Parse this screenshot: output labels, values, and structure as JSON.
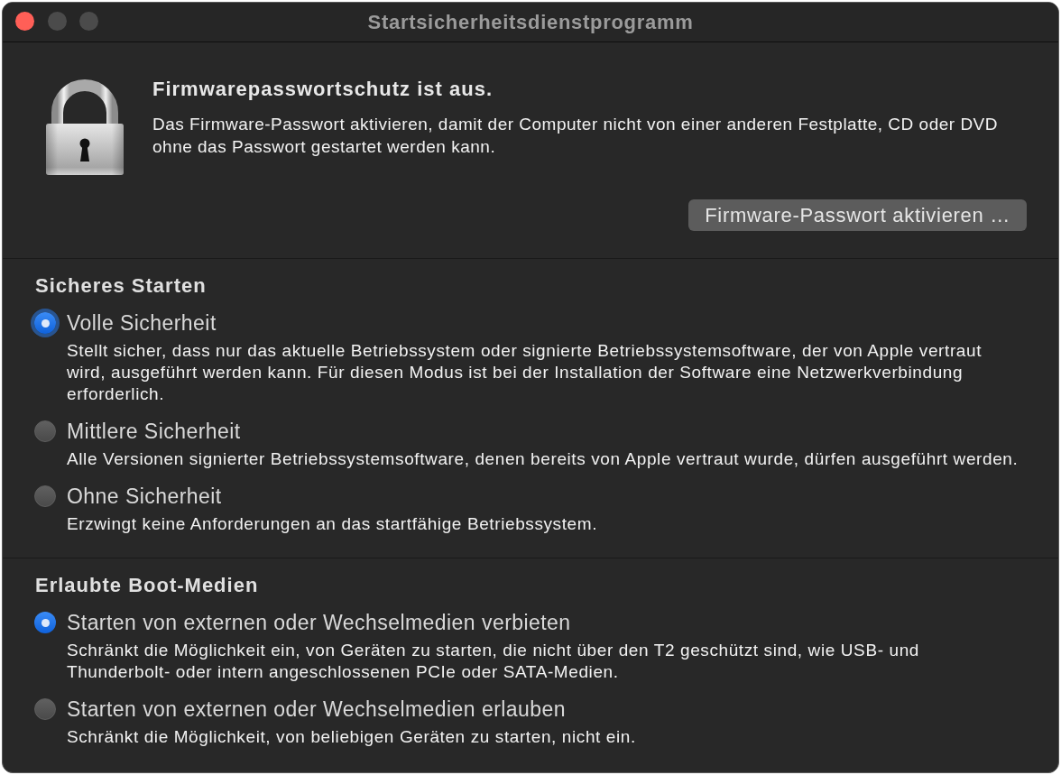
{
  "window": {
    "title": "Startsicherheitsdienstprogramm",
    "controls": [
      {
        "kind": "close",
        "disabled": false
      },
      {
        "kind": "minimize",
        "disabled": true
      },
      {
        "kind": "zoom",
        "disabled": true
      }
    ]
  },
  "firmware": {
    "heading": "Firmwarepasswortschutz ist aus.",
    "description": "Das Firmware-Passwort aktivieren, damit der Computer nicht von einer anderen Festplatte, CD oder DVD ohne das Passwort gestartet werden kann.",
    "button": "Firmware-Passwort aktivieren …"
  },
  "sections": [
    {
      "title": "Sicheres Starten",
      "options": [
        {
          "label": "Volle Sicherheit",
          "description": "Stellt sicher, dass nur das aktuelle Betriebssystem oder signierte Betriebssystemsoftware, der von Apple vertraut wird, ausgeführt werden kann. Für diesen Modus ist bei der Installation der Software eine Netzwerkverbindung erforderlich.",
          "selected": true,
          "focused": true
        },
        {
          "label": "Mittlere Sicherheit",
          "description": "Alle Versionen signierter Betriebssystemsoftware, denen bereits von Apple vertraut wurde, dürfen ausgeführt werden.",
          "selected": false,
          "focused": false
        },
        {
          "label": "Ohne Sicherheit",
          "description": "Erzwingt keine Anforderungen an das startfähige Betriebssystem.",
          "selected": false,
          "focused": false
        }
      ]
    },
    {
      "title": "Erlaubte Boot-Medien",
      "options": [
        {
          "label": "Starten von externen oder Wechselmedien verbieten",
          "description": "Schränkt die Möglichkeit ein, von Geräten zu starten, die nicht über den T2 geschützt sind, wie USB- und Thunderbolt- oder intern angeschlossenen PCIe oder SATA-Medien.",
          "selected": true,
          "focused": false
        },
        {
          "label": "Starten von externen oder Wechselmedien erlauben",
          "description": "Schränkt die Möglichkeit, von beliebigen Geräten zu starten, nicht ein.",
          "selected": false,
          "focused": false
        }
      ]
    }
  ]
}
